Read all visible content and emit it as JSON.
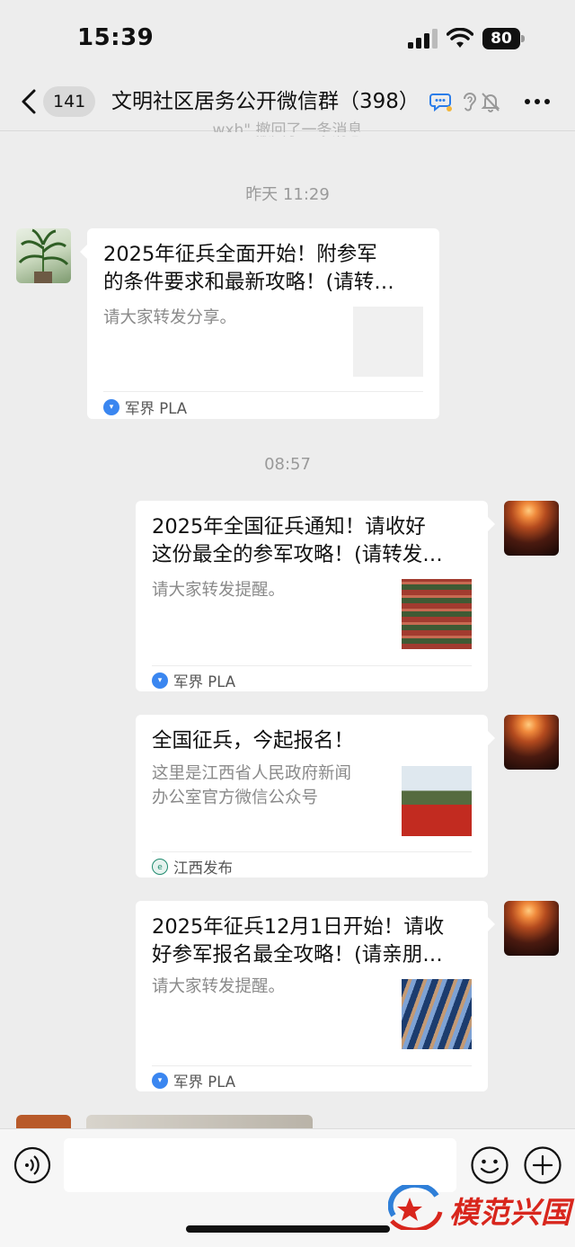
{
  "status": {
    "time": "15:39",
    "battery": "80"
  },
  "nav": {
    "badge": "141",
    "title": "文明社区居务公开微信群（398）"
  },
  "cutoff_line": "wxh\" 撤回了一条消息",
  "timestamps": [
    "昨天 11:29",
    "08:57"
  ],
  "messages": [
    {
      "side": "left",
      "title": "2025年征兵全面开始！附参军\n的条件要求和最新攻略！(请转…",
      "desc": "请大家转发分享。",
      "source": "军界 PLA"
    },
    {
      "side": "right",
      "title": "2025年全国征兵通知！请收好\n这份最全的参军攻略！(请转发…",
      "desc": "请大家转发提醒。",
      "source": "军界 PLA"
    },
    {
      "side": "right",
      "title": "全国征兵，今起报名！",
      "desc": "这里是江西省人民政府新闻\n办公室官方微信公众号",
      "source": "江西发布"
    },
    {
      "side": "right",
      "title": "2025年征兵12月1日开始！请收\n好参军报名最全攻略！(请亲朋…",
      "desc": "请大家转发提醒。",
      "source": "军界 PLA"
    }
  ],
  "watermark": "模范兴国",
  "icons": {
    "back": "chevron-left-icon",
    "more": "more-dots-icon",
    "voice": "voice-icon",
    "emoji": "emoji-icon",
    "plus": "plus-icon"
  },
  "colors": {
    "background": "#ededed",
    "card": "#ffffff",
    "source_icon": "#3a86f0",
    "watermark": "#d8261d"
  }
}
